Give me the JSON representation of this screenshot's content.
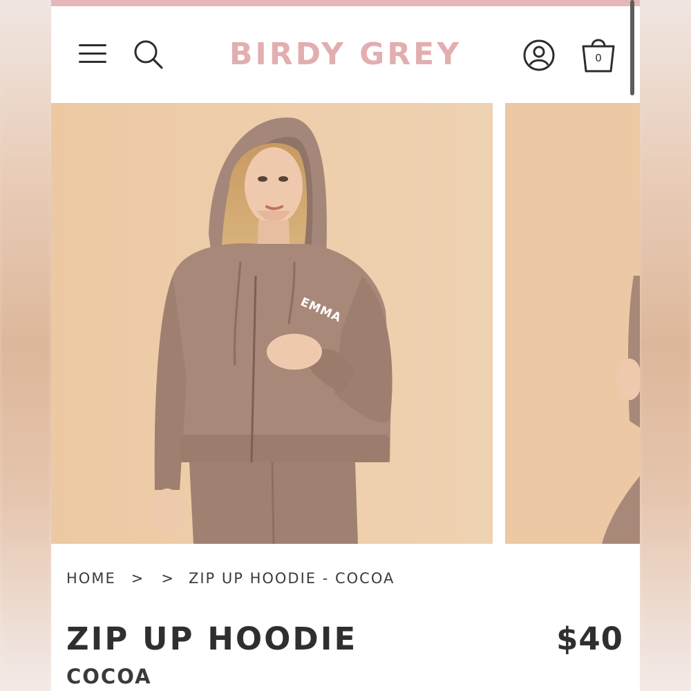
{
  "colors": {
    "brand_pink": "#e3aeb0",
    "top_strip": "#e6b7b9",
    "text_dark": "#2f2f2f",
    "photo_background": "#ebcaa5",
    "hoodie_cocoa": "#a88878"
  },
  "header": {
    "menu_icon": "hamburger-menu-icon",
    "search_icon": "search-icon",
    "brand": "BIRDY GREY",
    "account_icon": "user-account-icon",
    "cart_icon": "shopping-bag-icon",
    "cart_count": "0"
  },
  "gallery": {
    "slides": [
      {
        "embroidery": "EMMA"
      },
      {}
    ]
  },
  "breadcrumb": {
    "home": "HOME",
    "separator": ">",
    "current": "ZIP UP HOODIE - COCOA"
  },
  "product": {
    "title": "ZIP UP HOODIE",
    "variant": "COCOA",
    "price": "$40"
  }
}
